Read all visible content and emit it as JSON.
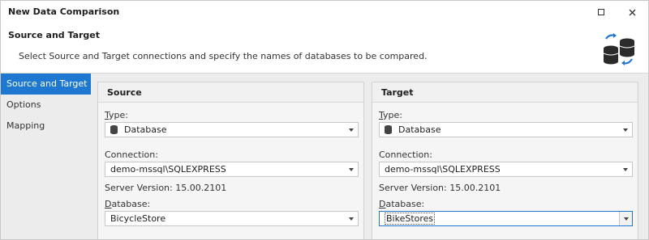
{
  "window": {
    "title": "New Data Comparison"
  },
  "header": {
    "title": "Source and Target",
    "description": "Select Source and Target connections and specify the names of databases to be compared.",
    "icon": "database-compare-icon"
  },
  "sidebar": {
    "items": [
      {
        "label": "Source and Target",
        "active": true
      },
      {
        "label": "Options",
        "active": false
      },
      {
        "label": "Mapping",
        "active": false
      }
    ]
  },
  "source": {
    "heading": "Source",
    "type_label_u": "T",
    "type_label_rest": "ype:",
    "type_value": "Database",
    "connection_label": "Connection:",
    "connection_value": "demo-mssql\\SQLEXPRESS",
    "server_version": "Server Version: 15.00.2101",
    "database_label_u": "D",
    "database_label_rest": "atabase:",
    "database_value": "BicycleStore"
  },
  "target": {
    "heading": "Target",
    "type_label_u": "T",
    "type_label_rest": "ype:",
    "type_value": "Database",
    "connection_label": "Connection:",
    "connection_value": "demo-mssql\\SQLEXPRESS",
    "server_version": "Server Version: 15.00.2101",
    "database_label_u": "D",
    "database_label_rest": "atabase:",
    "database_value": "BikeStores"
  },
  "colors": {
    "accent": "#1e78d2",
    "panel_bg": "#ececec"
  }
}
